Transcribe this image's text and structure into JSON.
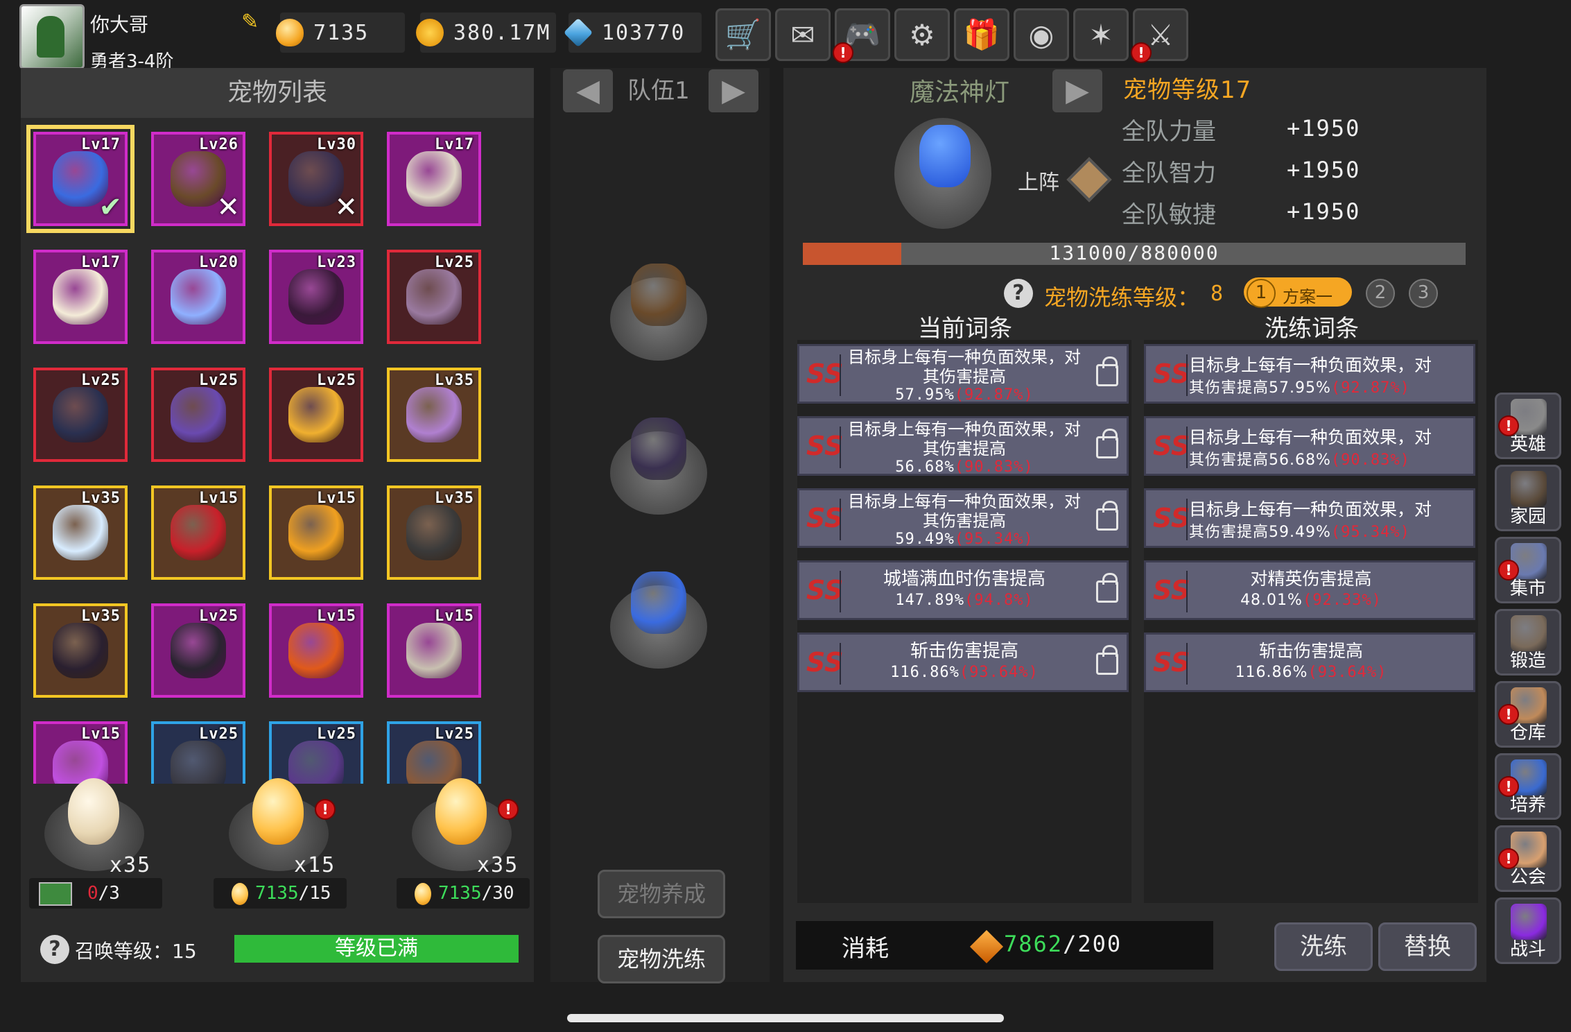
{
  "player": {
    "name": "你大哥",
    "rank": "勇者3-4阶"
  },
  "resources": {
    "gold": "7135",
    "coins": "380.17M",
    "gems": "103770"
  },
  "toolbar": [
    {
      "icon": "cart-icon",
      "alert": false
    },
    {
      "icon": "mail-icon",
      "alert": false
    },
    {
      "icon": "gamepad-icon",
      "alert": true
    },
    {
      "icon": "gear-icon",
      "alert": false
    },
    {
      "icon": "gift-icon",
      "alert": false
    },
    {
      "icon": "color-wheel-icon",
      "alert": false
    },
    {
      "icon": "feather-icon",
      "alert": false
    },
    {
      "icon": "crossed-swords-icon",
      "alert": true
    }
  ],
  "pet_list": {
    "title": "宠物列表",
    "pets": [
      {
        "lv": "Lv17",
        "quality": "purple",
        "color": "#3a6be0",
        "flag": "✔",
        "selected": true
      },
      {
        "lv": "Lv26",
        "quality": "purple",
        "color": "#6a4a2a",
        "flag": "✕"
      },
      {
        "lv": "Lv30",
        "quality": "red",
        "color": "#3a3050",
        "flag": "✕"
      },
      {
        "lv": "Lv17",
        "quality": "purple",
        "color": "#e0d8c8",
        "flag": ""
      },
      {
        "lv": "Lv17",
        "quality": "purple",
        "color": "#f4ecd8",
        "flag": ""
      },
      {
        "lv": "Lv20",
        "quality": "purple",
        "color": "#8fb0ff",
        "flag": ""
      },
      {
        "lv": "Lv23",
        "quality": "purple",
        "color": "#3a1a3a",
        "flag": ""
      },
      {
        "lv": "Lv25",
        "quality": "red",
        "color": "#9a7aa0",
        "flag": ""
      },
      {
        "lv": "Lv25",
        "quality": "red",
        "color": "#2a3050",
        "flag": ""
      },
      {
        "lv": "Lv25",
        "quality": "red",
        "color": "#6a4ab0",
        "flag": ""
      },
      {
        "lv": "Lv25",
        "quality": "red",
        "color": "#f0b030",
        "flag": ""
      },
      {
        "lv": "Lv35",
        "quality": "gold",
        "color": "#b080d0",
        "flag": ""
      },
      {
        "lv": "Lv35",
        "quality": "gold",
        "color": "#d8ecff",
        "flag": ""
      },
      {
        "lv": "Lv15",
        "quality": "gold",
        "color": "#c8202a",
        "flag": ""
      },
      {
        "lv": "Lv15",
        "quality": "gold",
        "color": "#f0a020",
        "flag": ""
      },
      {
        "lv": "Lv35",
        "quality": "gold",
        "color": "#3a3a3a",
        "flag": ""
      },
      {
        "lv": "Lv35",
        "quality": "gold",
        "color": "#2a2030",
        "flag": ""
      },
      {
        "lv": "Lv25",
        "quality": "purple",
        "color": "#2a2430",
        "flag": ""
      },
      {
        "lv": "Lv15",
        "quality": "purple",
        "color": "#e05a1a",
        "flag": ""
      },
      {
        "lv": "Lv15",
        "quality": "purple",
        "color": "#c8c0b0",
        "flag": ""
      },
      {
        "lv": "Lv15",
        "quality": "purple",
        "color": "#c050e0",
        "flag": ""
      },
      {
        "lv": "Lv25",
        "quality": "blue",
        "color": "#3a3a44",
        "flag": ""
      },
      {
        "lv": "Lv25",
        "quality": "blue",
        "color": "#5a3a8a",
        "flag": ""
      },
      {
        "lv": "Lv25",
        "quality": "blue",
        "color": "#8a5a3a",
        "flag": ""
      }
    ]
  },
  "eggs": [
    {
      "count": "x35",
      "cost_icon": "ad-video-icon",
      "cost_current": "0",
      "cost_total": "/3",
      "alert": false,
      "color": "w"
    },
    {
      "count": "x15",
      "cost_icon": "gold-egg-icon",
      "cost_current": "7135",
      "cost_total": "/15",
      "alert": true,
      "color": "o"
    },
    {
      "count": "x35",
      "cost_icon": "gold-egg-icon",
      "cost_current": "7135",
      "cost_total": "/30",
      "alert": true,
      "color": "o"
    }
  ],
  "summon": {
    "label": "召唤等级：15",
    "bar_text": "等级已满"
  },
  "team": {
    "label": "队伍1",
    "prev": "◀",
    "next": "▶",
    "slots": [
      "#6a4a2a",
      "#3a3050",
      "#3a6be0"
    ]
  },
  "mid_buttons": {
    "nurture": "宠物养成",
    "refine": "宠物洗练"
  },
  "pet_detail": {
    "name": "魔法神灯",
    "level": "宠物等级17",
    "deploy": "上阵",
    "stats": [
      {
        "name": "全队力量",
        "value": "+1950"
      },
      {
        "name": "全队智力",
        "value": "+1950"
      },
      {
        "name": "全队敏捷",
        "value": "+1950"
      }
    ],
    "exp_text": "131000/880000",
    "exp_ratio": 0.149
  },
  "refine": {
    "label": "宠物洗练等级：",
    "level": "8",
    "plan_num": "1",
    "plan_text": "方案一",
    "plan_others": [
      "2",
      "3"
    ]
  },
  "current_head": "当前词条",
  "refine_head": "洗练词条",
  "current_attrs": [
    {
      "grade": "SS",
      "line1": "目标身上每有一种负面效果，对其伤害提高",
      "value": "57.95%",
      "pct": "(92.87%)"
    },
    {
      "grade": "SS",
      "line1": "目标身上每有一种负面效果，对其伤害提高",
      "value": "56.68%",
      "pct": "(90.83%)"
    },
    {
      "grade": "SS",
      "line1": "目标身上每有一种负面效果，对其伤害提高",
      "value": "59.49%",
      "pct": "(95.34%)"
    },
    {
      "grade": "SS",
      "line1": "城墙满血时伤害提高",
      "value": "147.89%",
      "pct": "(94.8%)"
    },
    {
      "grade": "SS",
      "line1": "斩击伤害提高",
      "value": "116.86%",
      "pct": "(93.64%)"
    }
  ],
  "refine_attrs": [
    {
      "grade": "SS",
      "line1": "目标身上每有一种负面效果，对",
      "line2": "其伤害提高57.95%",
      "pct": "(92.87%)"
    },
    {
      "grade": "SS",
      "line1": "目标身上每有一种负面效果，对",
      "line2": "其伤害提高56.68%",
      "pct": "(90.83%)"
    },
    {
      "grade": "SS",
      "line1": "目标身上每有一种负面效果，对",
      "line2": "其伤害提高59.49%",
      "pct": "(95.34%)"
    },
    {
      "grade": "SS",
      "line1": "对精英伤害提高",
      "line2": "48.01%",
      "pct": "(92.33%)"
    },
    {
      "grade": "SS",
      "line1": "斩击伤害提高",
      "line2": "116.86%",
      "pct": "(93.64%)"
    }
  ],
  "cost": {
    "label": "消耗",
    "current": "7862",
    "total": "/200"
  },
  "actions": {
    "refine": "洗练",
    "replace": "替换"
  },
  "side_nav": [
    {
      "label": "英雄",
      "icon": "helmet-icon",
      "alert": true,
      "color": "#8a8a8a"
    },
    {
      "label": "家园",
      "icon": "castle-icon",
      "alert": false,
      "color": "#5a4a3a"
    },
    {
      "label": "集市",
      "icon": "shop-icon",
      "alert": true,
      "color": "#6a7ab0"
    },
    {
      "label": "锻造",
      "icon": "anvil-icon",
      "alert": false,
      "color": "#7a6a5a"
    },
    {
      "label": "仓库",
      "icon": "warehouse-icon",
      "alert": true,
      "color": "#c08a5a"
    },
    {
      "label": "培养",
      "icon": "trophy-icon",
      "alert": true,
      "color": "#3a6ad0"
    },
    {
      "label": "公会",
      "icon": "guild-icon",
      "alert": true,
      "color": "#d8a070"
    },
    {
      "label": "战斗",
      "icon": "portal-icon",
      "alert": false,
      "color": "#8a2ae0"
    }
  ]
}
